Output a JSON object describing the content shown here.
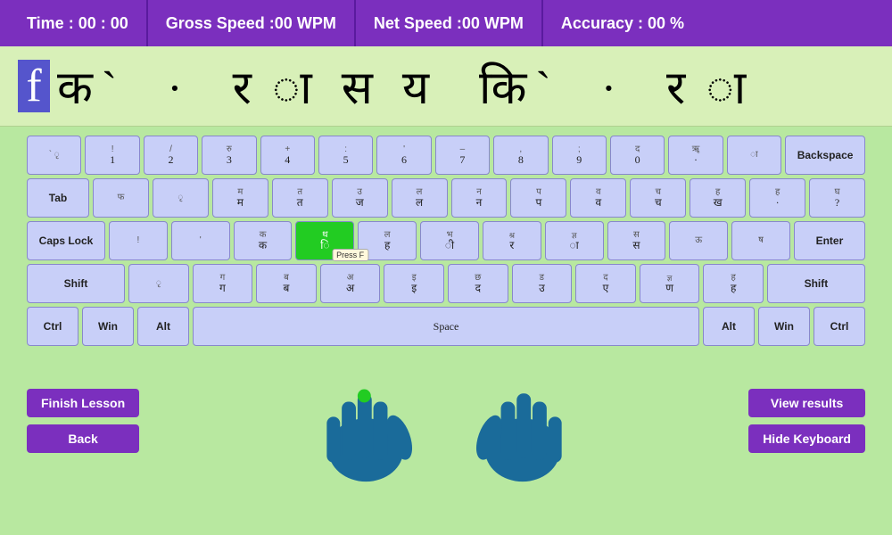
{
  "stats": {
    "time_label": "Time :",
    "time_value": "00 : 00",
    "gross_label": "Gross Speed :",
    "gross_value": "00",
    "gross_unit": "WPM",
    "net_label": "Net Speed :",
    "net_value": "00",
    "net_unit": "WPM",
    "accuracy_label": "Accuracy :",
    "accuracy_value": "00",
    "accuracy_unit": "%"
  },
  "text_display": {
    "cursor_char": "f",
    "text": "क`  ·  र ा स य  कि`  ·  र ा"
  },
  "keyboard": {
    "rows": [
      {
        "keys": [
          {
            "top": "` ",
            "bottom": "  ",
            "label": "` "
          },
          {
            "top": "!",
            "bottom": "1",
            "label": "!1"
          },
          {
            "top": "/",
            "bottom": "2",
            "label": "/2"
          },
          {
            "top": "रु",
            "bottom": "3",
            "label": "रु3"
          },
          {
            "top": "+",
            "bottom": "4",
            "label": "+4"
          },
          {
            "top": ":",
            "bottom": "5",
            "label": ":5"
          },
          {
            "top": "'",
            "bottom": "6",
            "label": "'6"
          },
          {
            "top": "–",
            "bottom": "7",
            "label": "–7"
          },
          {
            "top": ",",
            "bottom": "8",
            "label": ",8"
          },
          {
            "top": ";",
            "bottom": "9",
            "label": ";9"
          },
          {
            "top": "द",
            "bottom": "0",
            "label": "द0"
          },
          {
            "top": "ॠ",
            "bottom": "",
            "label": "ॠ"
          },
          {
            "top": "ा",
            "bottom": "",
            "label": "ा"
          },
          {
            "top": "Backspace",
            "bottom": "",
            "label": "Backspace",
            "wide": true
          }
        ]
      },
      {
        "keys": [
          {
            "top": "Tab",
            "bottom": "",
            "label": "Tab",
            "wide": true
          },
          {
            "top": "फ",
            "bottom": "",
            "label": "फ"
          },
          {
            "top": "ृ",
            "bottom": "",
            "label": "ृ"
          },
          {
            "top": "म",
            "bottom": "म",
            "label": "म"
          },
          {
            "top": "त",
            "bottom": "त",
            "label": "त"
          },
          {
            "top": "उ",
            "bottom": "ज",
            "label": "उज"
          },
          {
            "top": "ल",
            "bottom": "ल",
            "label": "ल"
          },
          {
            "top": "न",
            "bottom": "न",
            "label": "न"
          },
          {
            "top": "प",
            "bottom": "प",
            "label": "प"
          },
          {
            "top": "व",
            "bottom": "व",
            "label": "व"
          },
          {
            "top": "च",
            "bottom": "च",
            "label": "च"
          },
          {
            "top": "ह",
            "bottom": "ख",
            "label": "हख"
          },
          {
            "top": "ह",
            "bottom": "·",
            "label": "ह·"
          },
          {
            "top": "घ",
            "bottom": "?",
            "label": "घ?"
          }
        ]
      },
      {
        "keys": [
          {
            "top": "Caps Lock",
            "bottom": "",
            "label": "Caps Lock",
            "wide": true
          },
          {
            "top": "!",
            "bottom": "",
            "label": "!"
          },
          {
            "top": "' ",
            "bottom": "",
            "label": "'"
          },
          {
            "top": "क",
            "bottom": "क",
            "label": "क"
          },
          {
            "top": "थ",
            "bottom": "ि",
            "label": "थि",
            "highlighted": true
          },
          {
            "top": "ल",
            "bottom": "ह",
            "label": "लह"
          },
          {
            "top": "भ",
            "bottom": "ी",
            "label": "भी"
          },
          {
            "top": "श्र",
            "bottom": "र",
            "label": "श्रर"
          },
          {
            "top": "ज्ञ",
            "bottom": "ा",
            "label": "ज्ञा"
          },
          {
            "top": "स",
            "bottom": "स",
            "label": "स"
          },
          {
            "top": "ऊ",
            "bottom": "",
            "label": "ऊ"
          },
          {
            "top": "ष",
            "bottom": "",
            "label": "ष"
          },
          {
            "top": "Enter",
            "bottom": "",
            "label": "Enter",
            "wide": true
          }
        ]
      },
      {
        "keys": [
          {
            "top": "Shift",
            "bottom": "",
            "label": "Shift",
            "wide": true
          },
          {
            "top": "ृ",
            "bottom": "",
            "label": "ृ"
          },
          {
            "top": "ग",
            "bottom": "ग",
            "label": "ग"
          },
          {
            "top": "ब",
            "bottom": "ब",
            "label": "ब"
          },
          {
            "top": "अ",
            "bottom": "अ",
            "label": "अ",
            "press_hint": "Press F"
          },
          {
            "top": "इ",
            "bottom": "इ",
            "label": "इ"
          },
          {
            "top": "छ",
            "bottom": "द",
            "label": "छद"
          },
          {
            "top": "ड",
            "bottom": "उ",
            "label": "डउ"
          },
          {
            "top": "द",
            "bottom": "ए",
            "label": "दए"
          },
          {
            "top": "ज्ञ",
            "bottom": "ण",
            "label": "ज्ञण"
          },
          {
            "top": "ह",
            "bottom": "ह",
            "label": "हह"
          },
          {
            "top": "Shift",
            "bottom": "",
            "label": "Shift",
            "wide": true
          }
        ]
      },
      {
        "keys": [
          {
            "top": "Ctrl",
            "bottom": "",
            "label": "Ctrl"
          },
          {
            "top": "Win",
            "bottom": "",
            "label": "Win"
          },
          {
            "top": "Alt",
            "bottom": "",
            "label": "Alt"
          },
          {
            "top": "Space",
            "bottom": "",
            "label": "Space",
            "space": true
          },
          {
            "top": "Alt",
            "bottom": "",
            "label": "Alt"
          },
          {
            "top": "Win",
            "bottom": "",
            "label": "Win"
          },
          {
            "top": "Ctrl",
            "bottom": "",
            "label": "Ctrl"
          }
        ]
      }
    ]
  },
  "buttons": {
    "finish_lesson": "Finish Lesson",
    "back": "Back",
    "view_results": "View results",
    "hide_keyboard": "Hide Keyboard"
  }
}
